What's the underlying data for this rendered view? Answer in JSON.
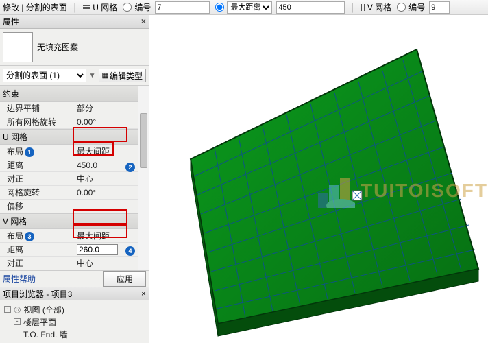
{
  "toolbar": {
    "modify_label": "修改 | 分割的表面",
    "u_grid_label": "U 网格",
    "u_number_label": "编号",
    "u_number_value": "7",
    "u_dist_options": "最大距离",
    "u_dist_value": "450",
    "v_grid_label": "V 网格",
    "v_number_label": "编号",
    "v_number_value": "9"
  },
  "panel": {
    "properties_title": "属性",
    "no_fill_pattern": "无填充图案",
    "selector": "分割的表面 (1)",
    "edit_type": "编辑类型",
    "sections": {
      "constraint": "约束",
      "u_grid": "U 网格",
      "v_grid": "V 网格"
    },
    "rows": {
      "boundary_tile_k": "边界平铺",
      "boundary_tile_v": "部分",
      "all_grid_rot_k": "所有网格旋转",
      "all_grid_rot_v": "0.00°",
      "layout_k": "布局",
      "layout_u_v": "最大间距",
      "layout_v_v": "最大间距",
      "distance_k": "距离",
      "distance_u_v": "450.0",
      "distance_v_v": "260.0",
      "justify_k": "对正",
      "justify_v": "中心",
      "grid_rot_k": "网格旋转",
      "grid_rot_v": "0.00°",
      "offset_k": "偏移"
    },
    "help_link": "属性帮助",
    "apply": "应用"
  },
  "browser": {
    "title": "项目浏览器 - 项目3",
    "root": "视图 (全部)",
    "child1": "楼层平面",
    "child2": "T.O. Fnd. 墙"
  },
  "badges": {
    "b1": "1",
    "b2": "2",
    "b3": "3",
    "b4": "4"
  },
  "watermark": "TUITOISOFT"
}
